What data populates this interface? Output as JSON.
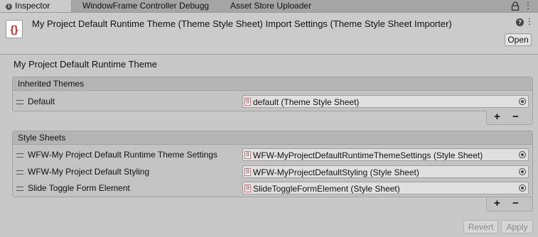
{
  "tabs": [
    {
      "label": "Inspector",
      "icon": "info-icon",
      "active": true
    },
    {
      "label": "WindowFrame Controller Debugg",
      "active": false
    },
    {
      "label": "Asset Store Uploader",
      "active": false
    }
  ],
  "header": {
    "icon_glyph": "{}",
    "title": "My Project Default Runtime Theme (Theme Style Sheet) Import Settings (Theme Style Sheet Importer)",
    "open_label": "Open",
    "help_glyph": "?",
    "menu_glyph": "⋮"
  },
  "section_title": "My Project Default Runtime Theme",
  "inherited": {
    "title": "Inherited Themes",
    "items": [
      {
        "label": "Default",
        "value": "default (Theme Style Sheet)"
      }
    ]
  },
  "stylesheets": {
    "title": "Style Sheets",
    "items": [
      {
        "label": "WFW-My Project Default Runtime Theme Settings",
        "value": "WFW-MyProjectDefaultRuntimeThemeSettings (Style Sheet)"
      },
      {
        "label": "WFW-My Project Default Styling",
        "value": "WFW-MyProjectDefaultStyling (Style Sheet)"
      },
      {
        "label": "Slide Toggle Form Element",
        "value": "SlideToggleFormElement (Style Sheet)"
      }
    ]
  },
  "list_controls": {
    "add": "+",
    "remove": "−"
  },
  "footer_buttons": {
    "revert": "Revert",
    "apply": "Apply"
  }
}
